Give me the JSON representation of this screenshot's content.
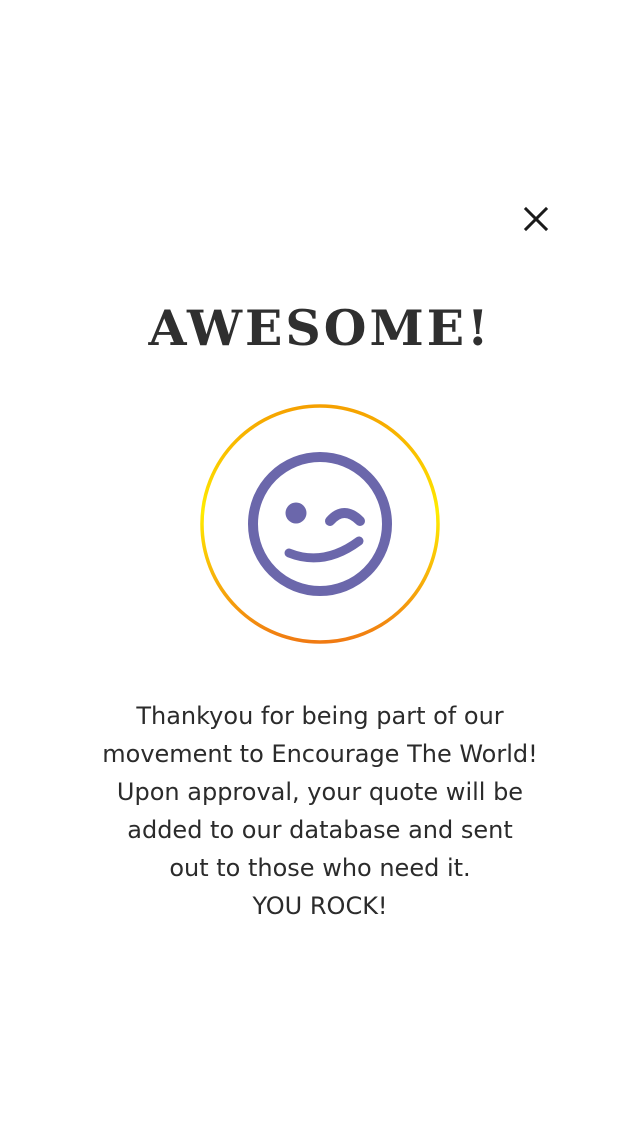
{
  "dialog": {
    "close_icon": "close-icon",
    "title": "AWESOME!",
    "emoji_icon": "wink-face-icon",
    "colors": {
      "ring_gradient_start": "#f5a400",
      "ring_gradient_mid": "#ffe600",
      "ring_gradient_end": "#f07c10",
      "emoji": "#6b67ab",
      "text": "#2b2b2b"
    },
    "message_lines": [
      "Thankyou for being part of our",
      "movement to Encourage The World!",
      "Upon approval, your quote will be",
      "added to our database and sent",
      "out to those who need it.",
      "YOU ROCK!"
    ]
  }
}
